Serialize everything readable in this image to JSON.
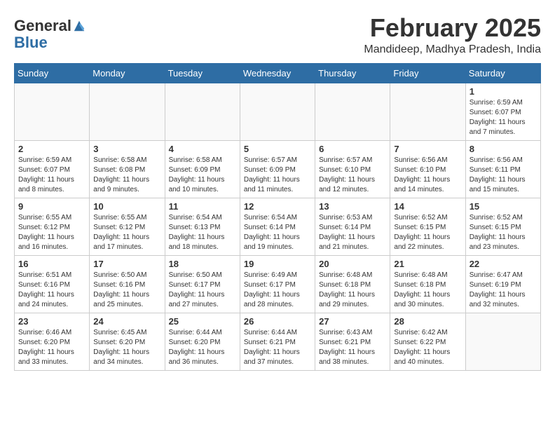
{
  "header": {
    "logo_line1": "General",
    "logo_line2": "Blue",
    "month": "February 2025",
    "location": "Mandideep, Madhya Pradesh, India"
  },
  "weekdays": [
    "Sunday",
    "Monday",
    "Tuesday",
    "Wednesday",
    "Thursday",
    "Friday",
    "Saturday"
  ],
  "weeks": [
    [
      {
        "day": "",
        "info": ""
      },
      {
        "day": "",
        "info": ""
      },
      {
        "day": "",
        "info": ""
      },
      {
        "day": "",
        "info": ""
      },
      {
        "day": "",
        "info": ""
      },
      {
        "day": "",
        "info": ""
      },
      {
        "day": "1",
        "info": "Sunrise: 6:59 AM\nSunset: 6:07 PM\nDaylight: 11 hours\nand 7 minutes."
      }
    ],
    [
      {
        "day": "2",
        "info": "Sunrise: 6:59 AM\nSunset: 6:07 PM\nDaylight: 11 hours\nand 8 minutes."
      },
      {
        "day": "3",
        "info": "Sunrise: 6:58 AM\nSunset: 6:08 PM\nDaylight: 11 hours\nand 9 minutes."
      },
      {
        "day": "4",
        "info": "Sunrise: 6:58 AM\nSunset: 6:09 PM\nDaylight: 11 hours\nand 10 minutes."
      },
      {
        "day": "5",
        "info": "Sunrise: 6:57 AM\nSunset: 6:09 PM\nDaylight: 11 hours\nand 11 minutes."
      },
      {
        "day": "6",
        "info": "Sunrise: 6:57 AM\nSunset: 6:10 PM\nDaylight: 11 hours\nand 12 minutes."
      },
      {
        "day": "7",
        "info": "Sunrise: 6:56 AM\nSunset: 6:10 PM\nDaylight: 11 hours\nand 14 minutes."
      },
      {
        "day": "8",
        "info": "Sunrise: 6:56 AM\nSunset: 6:11 PM\nDaylight: 11 hours\nand 15 minutes."
      }
    ],
    [
      {
        "day": "9",
        "info": "Sunrise: 6:55 AM\nSunset: 6:12 PM\nDaylight: 11 hours\nand 16 minutes."
      },
      {
        "day": "10",
        "info": "Sunrise: 6:55 AM\nSunset: 6:12 PM\nDaylight: 11 hours\nand 17 minutes."
      },
      {
        "day": "11",
        "info": "Sunrise: 6:54 AM\nSunset: 6:13 PM\nDaylight: 11 hours\nand 18 minutes."
      },
      {
        "day": "12",
        "info": "Sunrise: 6:54 AM\nSunset: 6:14 PM\nDaylight: 11 hours\nand 19 minutes."
      },
      {
        "day": "13",
        "info": "Sunrise: 6:53 AM\nSunset: 6:14 PM\nDaylight: 11 hours\nand 21 minutes."
      },
      {
        "day": "14",
        "info": "Sunrise: 6:52 AM\nSunset: 6:15 PM\nDaylight: 11 hours\nand 22 minutes."
      },
      {
        "day": "15",
        "info": "Sunrise: 6:52 AM\nSunset: 6:15 PM\nDaylight: 11 hours\nand 23 minutes."
      }
    ],
    [
      {
        "day": "16",
        "info": "Sunrise: 6:51 AM\nSunset: 6:16 PM\nDaylight: 11 hours\nand 24 minutes."
      },
      {
        "day": "17",
        "info": "Sunrise: 6:50 AM\nSunset: 6:16 PM\nDaylight: 11 hours\nand 25 minutes."
      },
      {
        "day": "18",
        "info": "Sunrise: 6:50 AM\nSunset: 6:17 PM\nDaylight: 11 hours\nand 27 minutes."
      },
      {
        "day": "19",
        "info": "Sunrise: 6:49 AM\nSunset: 6:17 PM\nDaylight: 11 hours\nand 28 minutes."
      },
      {
        "day": "20",
        "info": "Sunrise: 6:48 AM\nSunset: 6:18 PM\nDaylight: 11 hours\nand 29 minutes."
      },
      {
        "day": "21",
        "info": "Sunrise: 6:48 AM\nSunset: 6:18 PM\nDaylight: 11 hours\nand 30 minutes."
      },
      {
        "day": "22",
        "info": "Sunrise: 6:47 AM\nSunset: 6:19 PM\nDaylight: 11 hours\nand 32 minutes."
      }
    ],
    [
      {
        "day": "23",
        "info": "Sunrise: 6:46 AM\nSunset: 6:20 PM\nDaylight: 11 hours\nand 33 minutes."
      },
      {
        "day": "24",
        "info": "Sunrise: 6:45 AM\nSunset: 6:20 PM\nDaylight: 11 hours\nand 34 minutes."
      },
      {
        "day": "25",
        "info": "Sunrise: 6:44 AM\nSunset: 6:20 PM\nDaylight: 11 hours\nand 36 minutes."
      },
      {
        "day": "26",
        "info": "Sunrise: 6:44 AM\nSunset: 6:21 PM\nDaylight: 11 hours\nand 37 minutes."
      },
      {
        "day": "27",
        "info": "Sunrise: 6:43 AM\nSunset: 6:21 PM\nDaylight: 11 hours\nand 38 minutes."
      },
      {
        "day": "28",
        "info": "Sunrise: 6:42 AM\nSunset: 6:22 PM\nDaylight: 11 hours\nand 40 minutes."
      },
      {
        "day": "",
        "info": ""
      }
    ]
  ]
}
